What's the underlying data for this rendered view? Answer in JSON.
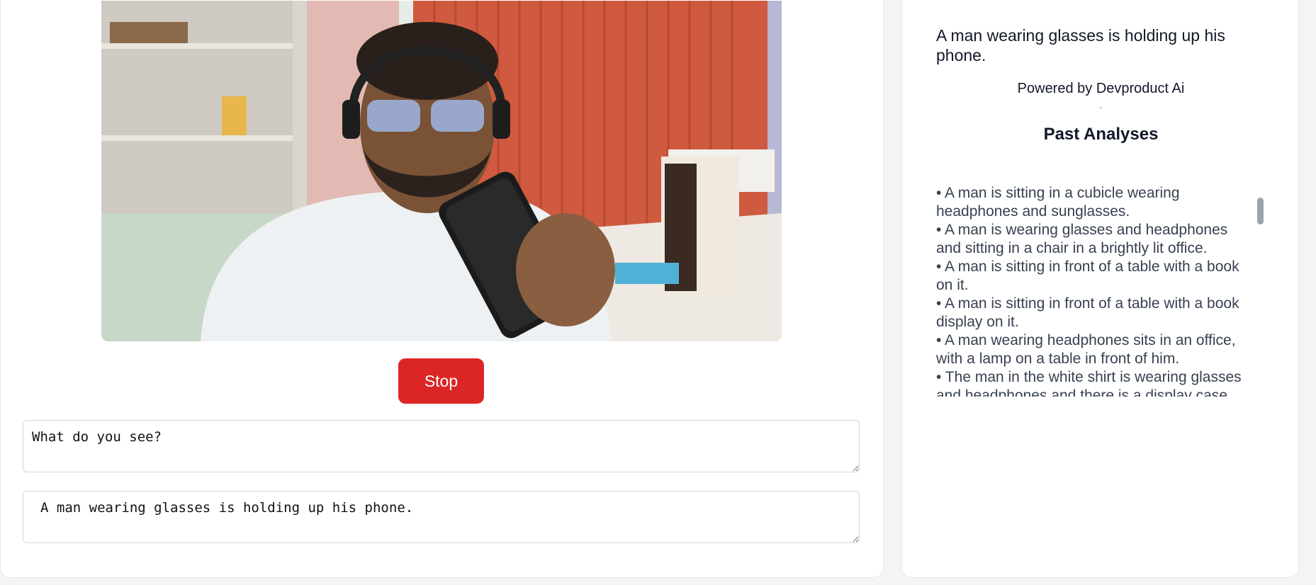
{
  "camera": {
    "feed_label": "camera-feed"
  },
  "controls": {
    "stop_label": "Stop"
  },
  "prompt": {
    "value": "What do you see?"
  },
  "response": {
    "value": "A man wearing glasses is holding up his phone."
  },
  "sidebar": {
    "current_caption": "A man wearing glasses is holding up his phone.",
    "powered_by": "Powered by Devproduct Ai",
    "past_title": "Past Analyses",
    "past_analyses": [
      "• A man is sitting in a cubicle wearing headphones and sunglasses.",
      "• A man is wearing glasses and headphones and sitting in a chair in a brightly lit office.",
      "• A man is sitting in front of a table with a book on it.",
      "• A man is sitting in front of a table with a book display on it.",
      "• A man wearing headphones sits in an office, with a lamp on a table in front of him.",
      "• The man in the white shirt is wearing glasses and headphones and there is a display case"
    ]
  },
  "colors": {
    "stop_button": "#dc2626",
    "page_background": "#f3f4f6"
  }
}
